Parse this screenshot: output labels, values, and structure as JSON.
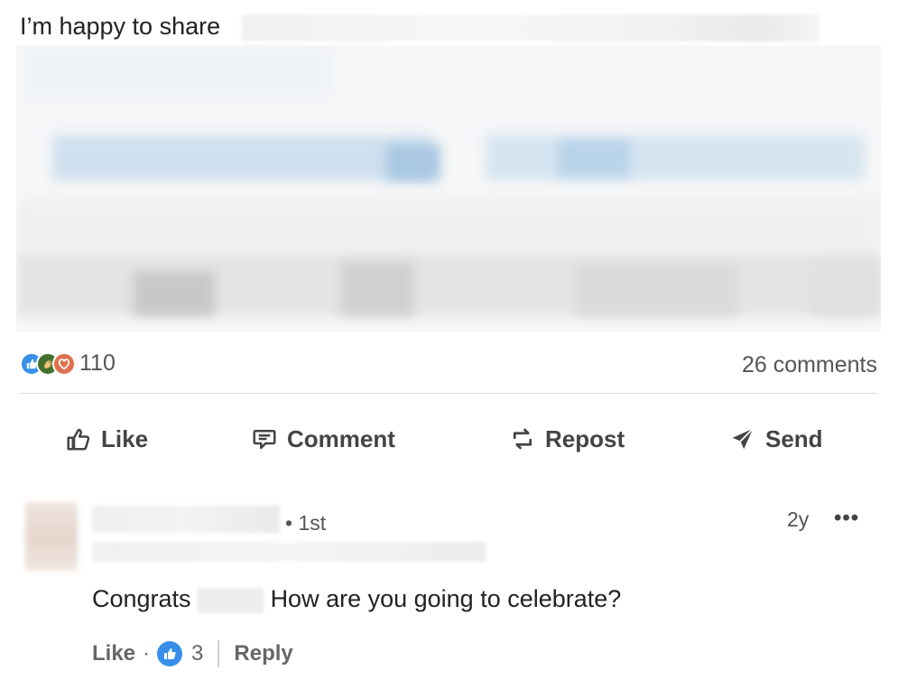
{
  "post": {
    "text": "I’m happy to share"
  },
  "social": {
    "reaction_count": "110",
    "comments_label": "26 comments",
    "reaction_icons": [
      "like-icon",
      "celebrate-icon",
      "love-icon"
    ]
  },
  "actions": {
    "like": "Like",
    "comment": "Comment",
    "repost": "Repost",
    "send": "Send"
  },
  "comment": {
    "degree": "• 1st",
    "age": "2y",
    "more": "•••",
    "text_before": "Congrats",
    "text_after": "How are you going to celebrate?",
    "like_label": "Like",
    "separator": "·",
    "like_count": "3",
    "reply_label": "Reply"
  },
  "colors": {
    "like_blue": "#378fe9",
    "celebrate_green": "#44712e",
    "love_red": "#df704d"
  }
}
